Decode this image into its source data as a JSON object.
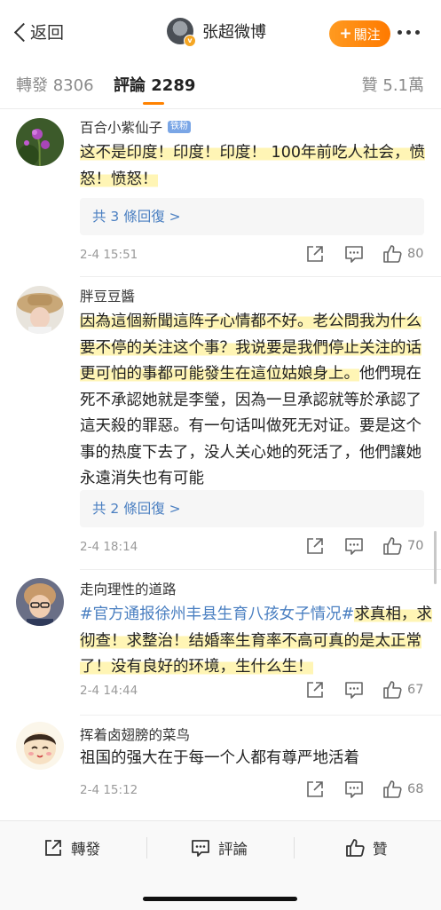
{
  "header": {
    "back_label": "返回",
    "title": "张超微博",
    "follow_label": "關注",
    "follow_plus": "+",
    "verified_badge": "v"
  },
  "tabs": {
    "repost": "轉發 8306",
    "comment": "評論 2289",
    "like": "贊 5.1萬"
  },
  "comments": [
    {
      "username": "百合小紫仙子",
      "badge": "铁粉",
      "text_hl": "这不是印度！印度！印度！ 100年前吃人社会，愤怒！愤怒！",
      "replies": "共 3 條回復 >",
      "time": "2-4 15:51",
      "likes": "80"
    },
    {
      "username": "胖豆豆醬",
      "text_hl": "因為這個新聞這阵子心情都不好。老公問我为什么要不停的关注这个事？我说要是我們停止关注的话更可怕的事都可能發生在這位姑娘身上。",
      "text_plain": "他們現在死不承認她就是李瑩，因為一旦承認就等於承認了這天殺的罪惡。有一句话叫做死无对证。要是这个事的热度下去了，没人关心她的死活了，他們讓她永遠消失也有可能",
      "replies": "共 2 條回復 >",
      "time": "2-4 18:14",
      "likes": "70"
    },
    {
      "username": "走向理性的道路",
      "hashtag": "#官方通报徐州丰县生育八孩女子情况#",
      "text_hl": "求真相，求彻查！求整治！结婚率生育率不高可真的是太正常了！没有良好的环境，生什么生！",
      "time": "2-4 14:44",
      "likes": "67"
    },
    {
      "username": "挥着卤翅膀的菜鸟",
      "text_plain": "祖国的强大在于每一个人都有尊严地活着",
      "time": "2-4 15:12",
      "likes": "68"
    }
  ],
  "bottom_bar": {
    "repost": "轉發",
    "comment": "評論",
    "like": "贊"
  },
  "colors": {
    "accent": "#ff8200",
    "link": "#4a7fc1",
    "highlight": "#fff5b5"
  }
}
